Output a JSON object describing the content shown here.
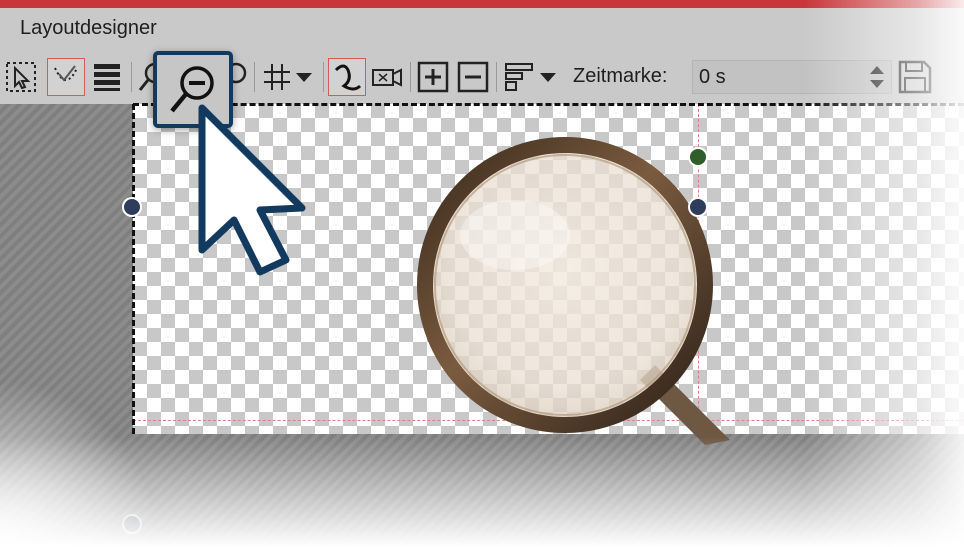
{
  "window": {
    "title": "Layoutdesigner"
  },
  "toolbar": {
    "time_label": "Zeitmarke:",
    "time_value": "0 s",
    "icons": [
      "select-region-icon",
      "snap-curve-icon",
      "layers-list-icon",
      "zoom-in-icon",
      "zoom-out-icon",
      "zoom-fit-icon",
      "grid-icon",
      "dropdown-arrow-icon",
      "motion-path-icon",
      "camera-icon",
      "add-icon",
      "remove-icon",
      "align-icon",
      "dropdown-arrow-icon",
      "spin-arrows-icon",
      "save-icon"
    ]
  },
  "colors": {
    "accent_bar": "#c8363a",
    "callout_border": "#12395e",
    "handle_blue": "#2e3d5c",
    "handle_green": "#2f5e2a",
    "active_button_border": "#d55a5a"
  }
}
